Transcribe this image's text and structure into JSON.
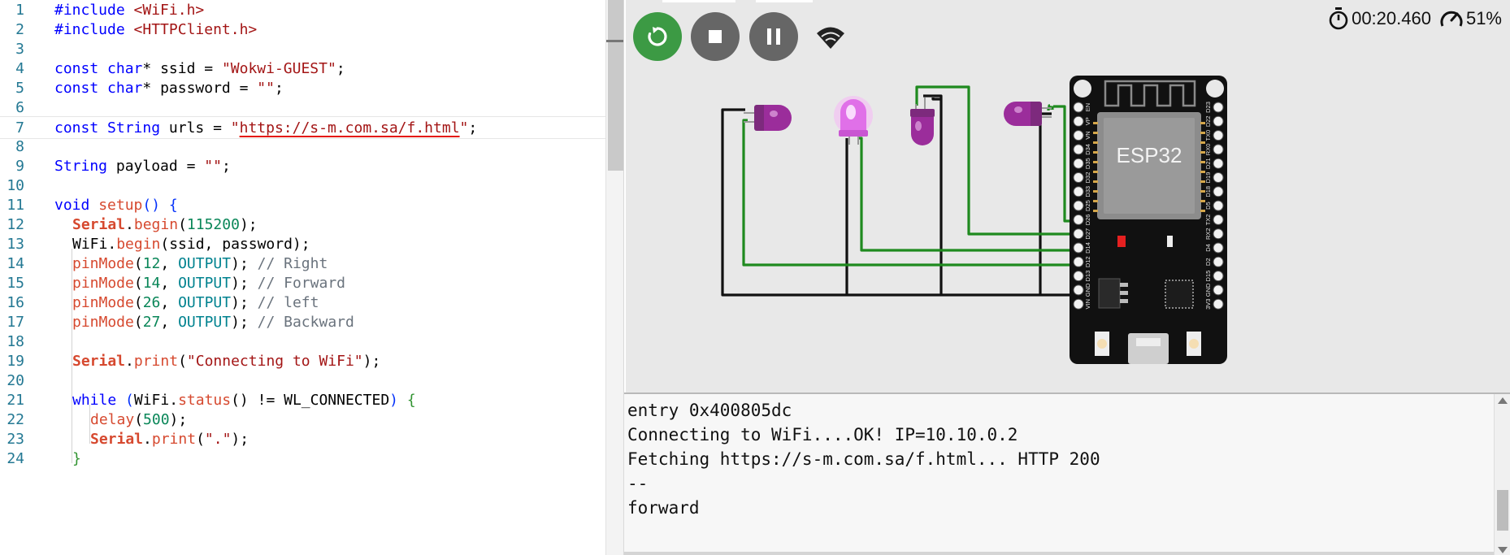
{
  "editor": {
    "lines": [
      {
        "n": "1",
        "indent": 0,
        "tokens": [
          {
            "t": "#include ",
            "c": "kw"
          },
          {
            "t": "<WiFi.h>",
            "c": "str"
          }
        ]
      },
      {
        "n": "2",
        "indent": 0,
        "tokens": [
          {
            "t": "#include ",
            "c": "kw"
          },
          {
            "t": "<HTTPClient.h>",
            "c": "str"
          }
        ]
      },
      {
        "n": "3",
        "indent": 0,
        "tokens": []
      },
      {
        "n": "4",
        "indent": 0,
        "tokens": [
          {
            "t": "const ",
            "c": "kw"
          },
          {
            "t": "char",
            "c": "kw"
          },
          {
            "t": "* ssid = ",
            "c": ""
          },
          {
            "t": "\"Wokwi-GUEST\"",
            "c": "str"
          },
          {
            "t": ";",
            "c": ""
          }
        ]
      },
      {
        "n": "5",
        "indent": 0,
        "tokens": [
          {
            "t": "const ",
            "c": "kw"
          },
          {
            "t": "char",
            "c": "kw"
          },
          {
            "t": "* password = ",
            "c": ""
          },
          {
            "t": "\"\"",
            "c": "str"
          },
          {
            "t": ";",
            "c": ""
          }
        ]
      },
      {
        "n": "6",
        "indent": 0,
        "tokens": []
      },
      {
        "n": "7",
        "indent": 0,
        "current": true,
        "tokens": [
          {
            "t": "const ",
            "c": "kw"
          },
          {
            "t": "String",
            "c": "kw"
          },
          {
            "t": " urls = ",
            "c": ""
          },
          {
            "t": "\"",
            "c": "str"
          },
          {
            "t": "https://s-m.com.sa/f.html",
            "c": "str squiggle"
          },
          {
            "t": "\"",
            "c": "str"
          },
          {
            "t": ";",
            "c": ""
          }
        ]
      },
      {
        "n": "8",
        "indent": 0,
        "tokens": []
      },
      {
        "n": "9",
        "indent": 0,
        "tokens": [
          {
            "t": "String",
            "c": "kw"
          },
          {
            "t": " payload = ",
            "c": ""
          },
          {
            "t": "\"\"",
            "c": "str"
          },
          {
            "t": ";",
            "c": ""
          }
        ]
      },
      {
        "n": "10",
        "indent": 0,
        "tokens": []
      },
      {
        "n": "11",
        "indent": 0,
        "tokens": [
          {
            "t": "void",
            "c": "kw"
          },
          {
            "t": " ",
            "c": ""
          },
          {
            "t": "setup",
            "c": "fn"
          },
          {
            "t": "()",
            "c": "paren"
          },
          {
            "t": " ",
            "c": ""
          },
          {
            "t": "{",
            "c": "paren"
          }
        ]
      },
      {
        "n": "12",
        "indent": 1,
        "tokens": [
          {
            "t": "Serial",
            "c": "bold"
          },
          {
            "t": ".",
            "c": ""
          },
          {
            "t": "begin",
            "c": "fn"
          },
          {
            "t": "(",
            "c": ""
          },
          {
            "t": "115200",
            "c": "num"
          },
          {
            "t": ");",
            "c": ""
          }
        ]
      },
      {
        "n": "13",
        "indent": 1,
        "tokens": [
          {
            "t": "WiFi.",
            "c": ""
          },
          {
            "t": "begin",
            "c": "fn"
          },
          {
            "t": "(ssid, password);",
            "c": ""
          }
        ]
      },
      {
        "n": "14",
        "indent": 1,
        "tokens": [
          {
            "t": "pinMode",
            "c": "fn"
          },
          {
            "t": "(",
            "c": ""
          },
          {
            "t": "12",
            "c": "num"
          },
          {
            "t": ", ",
            "c": ""
          },
          {
            "t": "OUTPUT",
            "c": "const"
          },
          {
            "t": "); ",
            "c": ""
          },
          {
            "t": "// Right",
            "c": "cm"
          }
        ]
      },
      {
        "n": "15",
        "indent": 1,
        "tokens": [
          {
            "t": "pinMode",
            "c": "fn"
          },
          {
            "t": "(",
            "c": ""
          },
          {
            "t": "14",
            "c": "num"
          },
          {
            "t": ", ",
            "c": ""
          },
          {
            "t": "OUTPUT",
            "c": "const"
          },
          {
            "t": "); ",
            "c": ""
          },
          {
            "t": "// Forward",
            "c": "cm"
          }
        ]
      },
      {
        "n": "16",
        "indent": 1,
        "tokens": [
          {
            "t": "pinMode",
            "c": "fn"
          },
          {
            "t": "(",
            "c": ""
          },
          {
            "t": "26",
            "c": "num"
          },
          {
            "t": ", ",
            "c": ""
          },
          {
            "t": "OUTPUT",
            "c": "const"
          },
          {
            "t": "); ",
            "c": ""
          },
          {
            "t": "// left",
            "c": "cm"
          }
        ]
      },
      {
        "n": "17",
        "indent": 1,
        "tokens": [
          {
            "t": "pinMode",
            "c": "fn"
          },
          {
            "t": "(",
            "c": ""
          },
          {
            "t": "27",
            "c": "num"
          },
          {
            "t": ", ",
            "c": ""
          },
          {
            "t": "OUTPUT",
            "c": "const"
          },
          {
            "t": "); ",
            "c": ""
          },
          {
            "t": "// Backward",
            "c": "cm"
          }
        ]
      },
      {
        "n": "18",
        "indent": 0,
        "tokens": []
      },
      {
        "n": "19",
        "indent": 1,
        "tokens": [
          {
            "t": "Serial",
            "c": "bold"
          },
          {
            "t": ".",
            "c": ""
          },
          {
            "t": "print",
            "c": "fn"
          },
          {
            "t": "(",
            "c": ""
          },
          {
            "t": "\"Connecting to WiFi\"",
            "c": "str"
          },
          {
            "t": ");",
            "c": ""
          }
        ]
      },
      {
        "n": "20",
        "indent": 0,
        "tokens": []
      },
      {
        "n": "21",
        "indent": 1,
        "tokens": [
          {
            "t": "while",
            "c": "kw"
          },
          {
            "t": " ",
            "c": ""
          },
          {
            "t": "(",
            "c": "paren"
          },
          {
            "t": "WiFi.",
            "c": ""
          },
          {
            "t": "status",
            "c": "fn"
          },
          {
            "t": "() != WL_CONNECTED",
            "c": ""
          },
          {
            "t": ")",
            "c": "paren"
          },
          {
            "t": " ",
            "c": ""
          },
          {
            "t": "{",
            "c": "brace"
          }
        ]
      },
      {
        "n": "22",
        "indent": 2,
        "tokens": [
          {
            "t": "delay",
            "c": "fn"
          },
          {
            "t": "(",
            "c": ""
          },
          {
            "t": "500",
            "c": "num"
          },
          {
            "t": ");",
            "c": ""
          }
        ]
      },
      {
        "n": "23",
        "indent": 2,
        "tokens": [
          {
            "t": "Serial",
            "c": "bold"
          },
          {
            "t": ".",
            "c": ""
          },
          {
            "t": "print",
            "c": "fn"
          },
          {
            "t": "(",
            "c": ""
          },
          {
            "t": "\".\"",
            "c": "str"
          },
          {
            "t": ");",
            "c": ""
          }
        ]
      },
      {
        "n": "24",
        "indent": 1,
        "tokens": [
          {
            "t": "}",
            "c": "brace"
          }
        ]
      }
    ]
  },
  "sim": {
    "controls": {
      "restart_icon": "restart-icon",
      "stop_icon": "stop-icon",
      "pause_icon": "pause-icon",
      "wifi_icon": "wifi-icon"
    },
    "status": {
      "elapsed": "00:20.460",
      "speed": "51%"
    },
    "board": {
      "label": "ESP32",
      "left_pins": [
        "EN",
        "VP",
        "VN",
        "D34",
        "D35",
        "D32",
        "D33",
        "D25",
        "D26",
        "D27",
        "D14",
        "D12",
        "D13",
        "GND",
        "VIN"
      ],
      "right_pins": [
        "D23",
        "D22",
        "TX0",
        "RX0",
        "D21",
        "D19",
        "D18",
        "D5",
        "TX2",
        "RX2",
        "D4",
        "D2",
        "D15",
        "GND",
        "3V3"
      ]
    },
    "leds": [
      {
        "name": "led-right",
        "color": "#9b2d9b",
        "lit": false
      },
      {
        "name": "led-forward",
        "color": "#e070e8",
        "lit": true
      },
      {
        "name": "led-left",
        "color": "#9b2d9b",
        "lit": false
      },
      {
        "name": "led-backward",
        "color": "#9b2d9b",
        "lit": false
      }
    ]
  },
  "serial": {
    "lines": [
      "entry 0x400805dc",
      "Connecting to WiFi....OK! IP=10.10.0.2",
      "Fetching https://s-m.com.sa/f.html... HTTP 200",
      "--",
      "forward"
    ]
  },
  "colors": {
    "accent_green": "#3c9a44",
    "control_gray": "#666666",
    "wire_green": "#1f8a1f",
    "wire_black": "#111111"
  }
}
